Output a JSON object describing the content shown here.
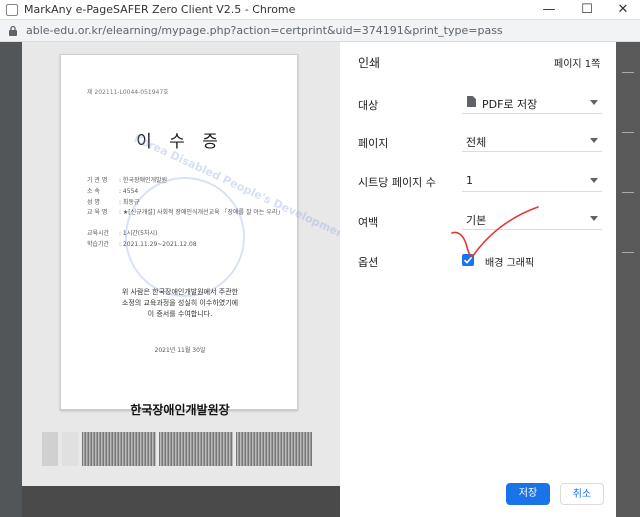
{
  "window": {
    "title": "MarkAny e-PageSAFER Zero Client V2.5 - Chrome",
    "minimize": "—",
    "maximize": "☐",
    "close": "✕"
  },
  "address": {
    "url": "able-edu.or.kr/elearning/mypage.php?action=certprint&uid=374191&print_type=pass"
  },
  "certificate": {
    "doc_number": "제 202111-L0044-051947호",
    "title": "이 수 증",
    "fields": [
      {
        "label": "기 관 명",
        "value": ": 한국장애인개발원"
      },
      {
        "label": "소    속",
        "value": ": 4554"
      },
      {
        "label": "성    명",
        "value": ": 최동규"
      },
      {
        "label": "교 육 명",
        "value": ": ★[신규개설] 사회적 장애인식개선교육 「장애를 잘 아는 우리」"
      },
      {
        "label": "교육시간",
        "value": ": 1시간(5차시)"
      },
      {
        "label": "학습기간",
        "value": ": 2021.11.29~2021.12.08"
      }
    ],
    "body_line1": "위 사람은 한국장애인개발원에서 주관한",
    "body_line2": "소정의 교육과정을 성실히 이수하였기에",
    "body_line3": "이 증서를 수여합니다.",
    "date": "2021년 11월 30일",
    "issuer": "한국장애인개발원장",
    "watermark": "Korea Disabled People's Development Institute"
  },
  "print_panel": {
    "title": "인쇄",
    "page_count": "페이지 1쪽",
    "destination_label": "대상",
    "destination_value": "PDF로 저장",
    "pages_label": "페이지",
    "pages_value": "전체",
    "pages_per_sheet_label": "시트당 페이지 수",
    "pages_per_sheet_value": "1",
    "margins_label": "여백",
    "margins_value": "기본",
    "options_label": "옵션",
    "background_graphics_label": "배경 그래픽",
    "background_graphics_checked": true,
    "save_button": "저장",
    "cancel_button": "취소"
  },
  "colors": {
    "accent": "#1a73e8",
    "annotation": "#e53935"
  }
}
